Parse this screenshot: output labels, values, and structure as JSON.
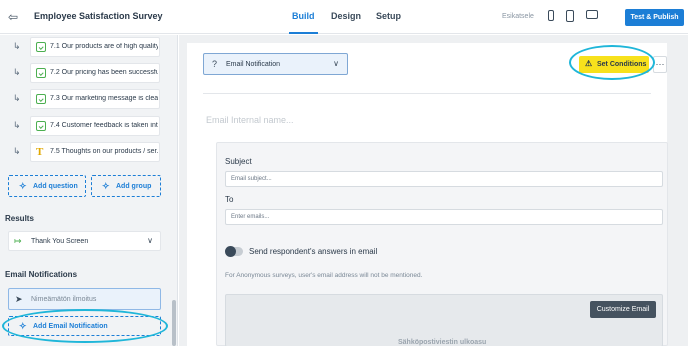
{
  "header": {
    "back_icon": "exit-arrow-icon",
    "title": "Employee Satisfaction Survey",
    "tabs": [
      {
        "label": "Build",
        "active": true
      },
      {
        "label": "Design",
        "active": false
      },
      {
        "label": "Setup",
        "active": false
      }
    ],
    "preview_label": "Esikatsele",
    "device_icons": [
      "mobile-icon",
      "tablet-icon",
      "desktop-icon"
    ],
    "publish_label": "Test & Publish",
    "accent": "#1c7ed6"
  },
  "sidebar": {
    "questions": [
      {
        "label": "7.1 Our products are of high quality",
        "icon": "checkbox-icon"
      },
      {
        "label": "7.2 Our pricing has been successful",
        "icon": "checkbox-icon"
      },
      {
        "label": "7.3 Our marketing message is clear",
        "icon": "checkbox-icon"
      },
      {
        "label": "7.4 Customer feedback is taken int...",
        "icon": "checkbox-icon"
      },
      {
        "label": "7.5 Thoughts on our products / ser...",
        "icon": "text-icon"
      }
    ],
    "add_question": "Add question",
    "add_group": "Add group",
    "results_title": "Results",
    "results_item": "Thank You Screen",
    "notifications_title": "Email Notifications",
    "notification_item": "Nimeämätön ilmoitus",
    "add_email_notification": "Add Email Notification"
  },
  "main": {
    "type_select": "Email Notification",
    "set_conditions": "Set Conditions",
    "more": "···",
    "internal_name_placeholder": "Email Internal name...",
    "subject_label": "Subject",
    "subject_placeholder": "Email subject...",
    "to_label": "To",
    "to_placeholder": "Enter emails...",
    "send_answers_label": "Send respondent's answers in email",
    "send_answers_on": false,
    "anon_note": "For Anonymous surveys, user's email address will not be mentioned.",
    "customize_email": "Customize Email",
    "email_layout_label": "Sähköpostiviestin ulkoasu",
    "highlight_color": "#f7e11c"
  }
}
